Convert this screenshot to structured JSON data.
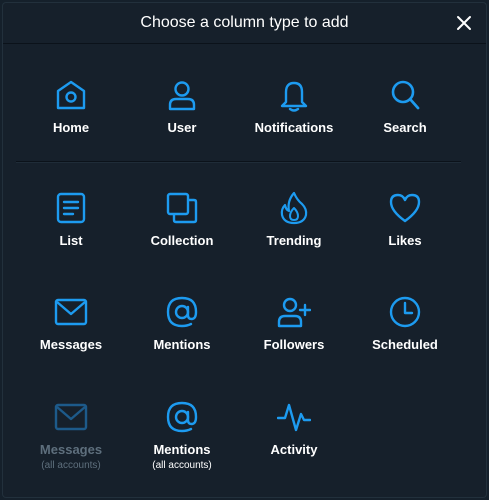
{
  "dialog": {
    "title": "Choose a column type to add"
  },
  "colors": {
    "background": "#16202b",
    "accent": "#1d9bf0",
    "disabled_icon": "#1d5a8a",
    "text": "#ffffff",
    "disabled_text": "#5e6f7d"
  },
  "columns": {
    "home": {
      "label": "Home",
      "icon": "home-icon"
    },
    "user": {
      "label": "User",
      "icon": "user-icon"
    },
    "notifications": {
      "label": "Notifications",
      "icon": "bell-icon"
    },
    "search": {
      "label": "Search",
      "icon": "search-icon"
    },
    "list": {
      "label": "List",
      "icon": "list-icon"
    },
    "collection": {
      "label": "Collection",
      "icon": "collection-icon"
    },
    "trending": {
      "label": "Trending",
      "icon": "flame-icon"
    },
    "likes": {
      "label": "Likes",
      "icon": "heart-icon"
    },
    "messages": {
      "label": "Messages",
      "icon": "envelope-icon"
    },
    "mentions": {
      "label": "Mentions",
      "icon": "at-icon"
    },
    "followers": {
      "label": "Followers",
      "icon": "user-plus-icon"
    },
    "scheduled": {
      "label": "Scheduled",
      "icon": "clock-icon"
    },
    "messages_all": {
      "label": "Messages",
      "sub": "(all accounts)",
      "icon": "envelope-icon",
      "disabled": true
    },
    "mentions_all": {
      "label": "Mentions",
      "sub": "(all accounts)",
      "icon": "at-icon"
    },
    "activity": {
      "label": "Activity",
      "icon": "activity-icon"
    }
  }
}
